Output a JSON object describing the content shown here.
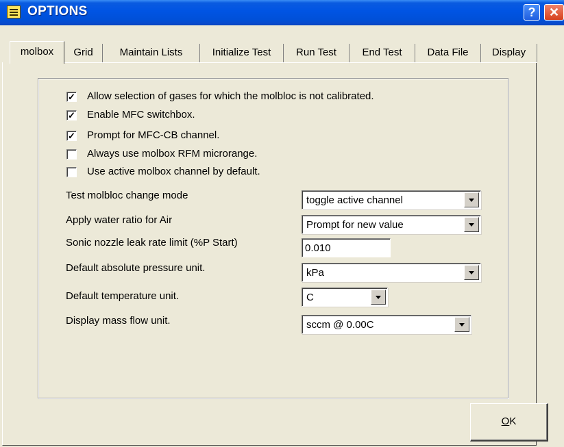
{
  "window": {
    "title": "OPTIONS",
    "help_label": "?",
    "close_label": "✕"
  },
  "tabs": [
    {
      "label": "molbox",
      "active": true
    },
    {
      "label": "Grid",
      "active": false
    },
    {
      "label": "Maintain Lists",
      "active": false
    },
    {
      "label": "Initialize Test",
      "active": false
    },
    {
      "label": "Run Test",
      "active": false
    },
    {
      "label": "End Test",
      "active": false
    },
    {
      "label": "Data File",
      "active": false
    },
    {
      "label": "Display",
      "active": false
    }
  ],
  "checkboxes": [
    {
      "label": "Allow selection of gases for which the molbloc is not calibrated.",
      "checked": true,
      "mark": "✓"
    },
    {
      "label": "Enable MFC switchbox.",
      "checked": true,
      "mark": "✓"
    },
    {
      "label": "Prompt for MFC-CB channel.",
      "checked": true,
      "mark": "✓"
    },
    {
      "label": "Always use molbox RFM microrange.",
      "checked": false,
      "mark": ""
    },
    {
      "label": "Use active molbox channel by default.",
      "checked": false,
      "mark": ""
    }
  ],
  "fields": {
    "test_change_mode": {
      "label": "Test molbloc change mode",
      "value": "toggle active channel"
    },
    "water_ratio": {
      "label": "Apply water ratio for Air",
      "value": "Prompt for new value"
    },
    "leak_rate": {
      "label": "Sonic nozzle leak rate limit (%P Start)",
      "value": "0.010"
    },
    "pressure_unit": {
      "label": "Default absolute pressure unit.",
      "value": "kPa"
    },
    "temperature_unit": {
      "label": "Default temperature unit.",
      "value": "C"
    },
    "mass_flow_unit": {
      "label": "Display mass flow unit.",
      "value": "sccm @ 0.00C"
    }
  },
  "ok_button": {
    "label": "OK",
    "accel": "O",
    "rest": "K"
  }
}
